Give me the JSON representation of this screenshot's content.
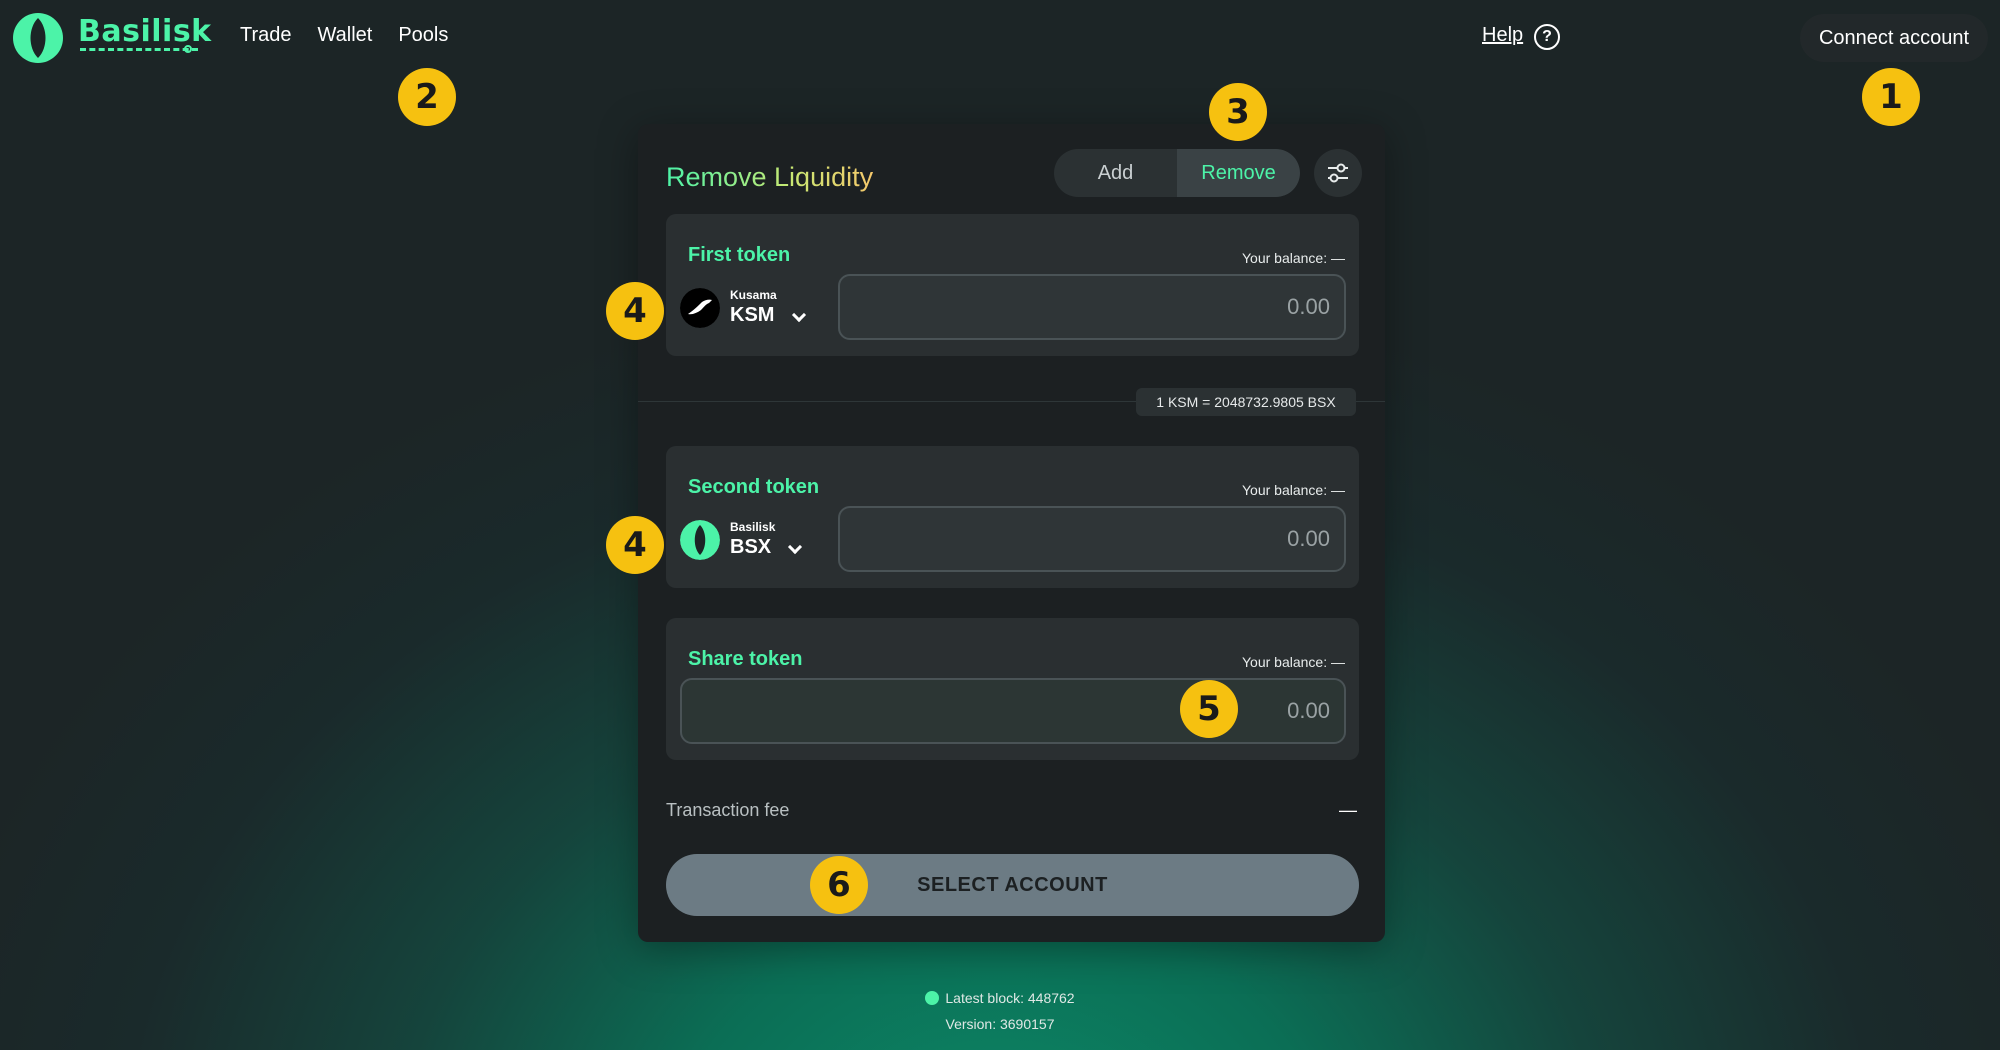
{
  "header": {
    "brand": "Basilisk",
    "nav": [
      "Trade",
      "Wallet",
      "Pools"
    ],
    "help_label": "Help",
    "help_icon": "question-icon",
    "connect_label": "Connect account"
  },
  "markers": [
    "1",
    "2",
    "3",
    "4",
    "4",
    "5",
    "6"
  ],
  "card": {
    "title": "Remove Liquidity",
    "tabs": {
      "add": "Add",
      "remove": "Remove"
    },
    "settings_icon": "sliders-icon",
    "first": {
      "label": "First token",
      "balance": "Your balance: —",
      "token_name": "Kusama",
      "token_symbol": "KSM",
      "amount": "0.00"
    },
    "rate": "1 KSM = 2048732.9805 BSX",
    "second": {
      "label": "Second token",
      "balance": "Your balance: —",
      "token_name": "Basilisk",
      "token_symbol": "BSX",
      "amount": "0.00"
    },
    "share": {
      "label": "Share token",
      "balance": "Your balance: —",
      "amount": "0.00"
    },
    "fee_label": "Transaction fee",
    "fee_value": "—",
    "cta": "SELECT ACCOUNT"
  },
  "footer": {
    "latest_block": "Latest block: 448762",
    "version": "Version: 3690157"
  },
  "colors": {
    "accent": "#4cf3a8",
    "marker": "#f6c110",
    "card_bg": "#1c2022",
    "cta_bg": "#6c7b84"
  }
}
